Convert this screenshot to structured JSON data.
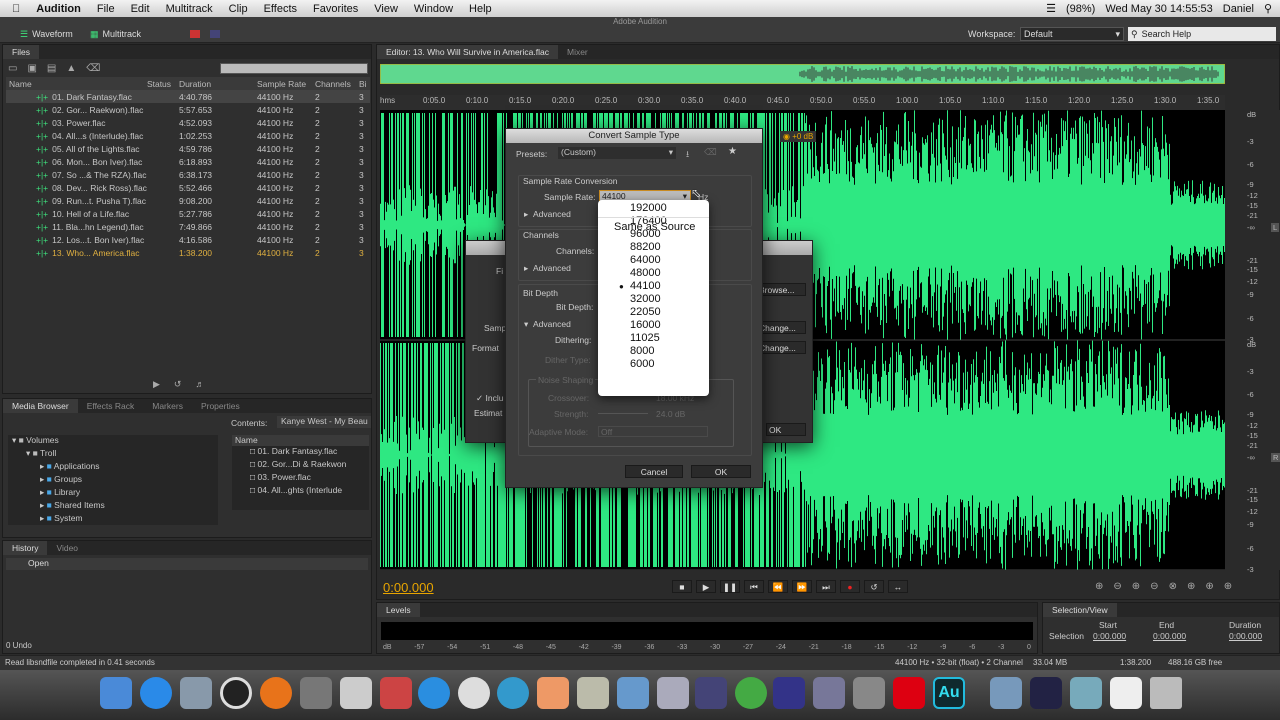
{
  "menubar": {
    "app": "Audition",
    "items": [
      "File",
      "Edit",
      "Multitrack",
      "Clip",
      "Effects",
      "Favorites",
      "View",
      "Window",
      "Help"
    ],
    "battery": "(98%)",
    "clock": "Wed May 30  14:55:53",
    "user": "Daniel"
  },
  "window_title": "Adobe Audition",
  "toolbar": {
    "waveform": "Waveform",
    "multitrack": "Multitrack",
    "workspace_label": "Workspace:",
    "workspace_value": "Default",
    "search_help": "Search Help"
  },
  "files": {
    "tab": "Files",
    "columns": [
      "Name",
      "Status",
      "Duration",
      "Sample Rate",
      "Channels",
      "Bi"
    ],
    "rows": [
      [
        "01. Dark Fantasy.flac",
        "4:40.786",
        "44100 Hz",
        "2",
        "3"
      ],
      [
        "02. Gor... Raekwon).flac",
        "5:57.653",
        "44100 Hz",
        "2",
        "3"
      ],
      [
        "03. Power.flac",
        "4:52.093",
        "44100 Hz",
        "2",
        "3"
      ],
      [
        "04. All...s (Interlude).flac",
        "1:02.253",
        "44100 Hz",
        "2",
        "3"
      ],
      [
        "05. All of the Lights.flac",
        "4:59.786",
        "44100 Hz",
        "2",
        "3"
      ],
      [
        "06. Mon... Bon Iver).flac",
        "6:18.893",
        "44100 Hz",
        "2",
        "3"
      ],
      [
        "07. So ...& The RZA).flac",
        "6:38.173",
        "44100 Hz",
        "2",
        "3"
      ],
      [
        "08. Dev... Rick Ross).flac",
        "5:52.466",
        "44100 Hz",
        "2",
        "3"
      ],
      [
        "09. Run...t. Pusha T).flac",
        "9:08.200",
        "44100 Hz",
        "2",
        "3"
      ],
      [
        "10. Hell of a Life.flac",
        "5:27.786",
        "44100 Hz",
        "2",
        "3"
      ],
      [
        "11. Bla...hn Legend).flac",
        "7:49.866",
        "44100 Hz",
        "2",
        "3"
      ],
      [
        "12. Los...t. Bon Iver).flac",
        "4:16.586",
        "44100 Hz",
        "2",
        "3"
      ],
      [
        "13. Who... America.flac",
        "1:38.200",
        "44100 Hz",
        "2",
        "3"
      ]
    ]
  },
  "media": {
    "tabs": [
      "Media Browser",
      "Effects Rack",
      "Markers",
      "Properties"
    ],
    "contents_label": "Contents:",
    "contents_value": "Kanye West - My Beau",
    "tree": [
      "Volumes",
      "Troll",
      "Applications",
      "Groups",
      "Library",
      "Shared Items",
      "System"
    ],
    "list_header": "Name",
    "list": [
      "01. Dark Fantasy.flac",
      "02. Gor...Di & Raekwon",
      "03. Power.flac",
      "04. All...ghts (Interlude"
    ]
  },
  "history": {
    "tabs": [
      "History",
      "Video"
    ],
    "items": [
      "Open"
    ],
    "undo": "0 Undo"
  },
  "status_left": "Read libsndfile completed in 0.41 seconds",
  "editor": {
    "tab": "Editor: 13. Who Will Survive in America.flac",
    "mixer": "Mixer",
    "ruler": [
      "hms",
      "0:05.0",
      "0:10.0",
      "0:15.0",
      "0:20.0",
      "0:25.0",
      "0:30.0",
      "0:35.0",
      "0:40.0",
      "0:45.0",
      "0:50.0",
      "0:55.0",
      "1:00.0",
      "1:05.0",
      "1:10.0",
      "1:15.0",
      "1:20.0",
      "1:25.0",
      "1:30.0",
      "1:35.0"
    ],
    "db_scale": [
      "dB",
      "-3",
      "-6",
      "-9",
      "-12",
      "-15",
      "-21",
      "-∞",
      "-21",
      "-15",
      "-12",
      "-9",
      "-6",
      "-3"
    ],
    "channel_labels": [
      "L",
      "R"
    ],
    "hud_gain": "+0 dB",
    "time": "0:00.000",
    "waveform_color": "#2ee882"
  },
  "dialog": {
    "title": "Convert Sample Type",
    "presets_label": "Presets:",
    "presets_value": "(Custom)",
    "src_group": "Sample Rate Conversion",
    "sample_rate_label": "Sample Rate:",
    "sample_rate_value": "44100",
    "hz": "Hz",
    "advanced": "Advanced",
    "channels_group": "Channels",
    "channels_label": "Channels:",
    "bit_group": "Bit Depth",
    "bit_label": "Bit Depth:",
    "dithering_label": "Dithering:",
    "dither_type": "Dither Type:",
    "noise_shaping": "Noise Shaping",
    "crossover": "Crossover:",
    "crossover_val": "18.00 kHz",
    "strength": "Strength:",
    "strength_val": "24.0 dB",
    "adaptive": "Adaptive Mode:",
    "adaptive_val": "Off",
    "cancel": "Cancel",
    "ok": "OK"
  },
  "back_dialog": {
    "browse": "Browse...",
    "change1": "Change...",
    "change2": "Change...",
    "ok": "OK",
    "include": "Inclu",
    "estimate": "Estimat",
    "fi": "Fi",
    "samp": "Samp",
    "format": "Format"
  },
  "dropdown": {
    "options": [
      "192000",
      "176400",
      "96000",
      "88200",
      "64000",
      "48000",
      "44100",
      "32000",
      "22050",
      "16000",
      "11025",
      "8000",
      "6000"
    ],
    "selected": "44100",
    "same": "Same as Source"
  },
  "levels": {
    "tab": "Levels",
    "scale": [
      "dB",
      "-57",
      "-54",
      "-51",
      "-48",
      "-45",
      "-42",
      "-39",
      "-36",
      "-33",
      "-30",
      "-27",
      "-24",
      "-21",
      "-18",
      "-15",
      "-12",
      "-9",
      "-6",
      "-3",
      "0"
    ]
  },
  "selection": {
    "tab": "Selection/View",
    "headers": [
      "Start",
      "End",
      "Duration"
    ],
    "row_label": "Selection",
    "values": [
      "0:00.000",
      "0:00.000",
      "0:00.000"
    ]
  },
  "statusbar": {
    "format": "44100 Hz • 32-bit (float) • 2 Channel",
    "size": "33.04 MB",
    "duration": "1:38.200",
    "free": "488.16 GB free"
  }
}
